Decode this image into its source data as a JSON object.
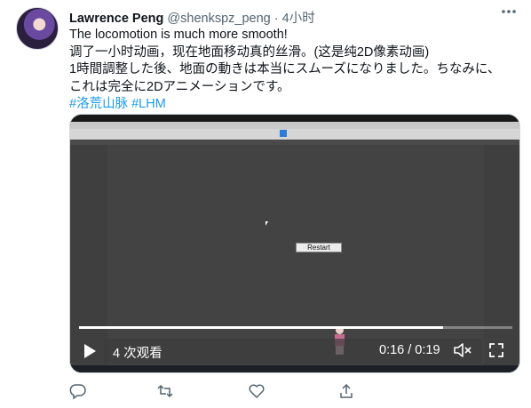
{
  "tweet": {
    "author_name": "Lawrence Peng",
    "handle": "@shenkspz_peng",
    "separator": "·",
    "time": "4小时",
    "lines": [
      "The locomotion is much more smooth!",
      "调了一小时动画，现在地面移动真的丝滑。(这是纯2D像素动画)",
      "1時間調整した後、地面の動きは本当にスムーズになりました。ちなみに、",
      "これは完全に2Dアニメーションです。"
    ],
    "hashtags": [
      "#洛荒山脉",
      "#LHM"
    ]
  },
  "video": {
    "restart_label": "Restart",
    "views": "4 次观看",
    "time_readout": "0:16 / 0:19",
    "progress": 0.84
  },
  "icons": {
    "more": "more-horizontal-icon",
    "play": "play-icon",
    "mute": "volume-muted-icon",
    "fullscreen": "fullscreen-icon",
    "reply": "reply-icon",
    "retweet": "retweet-icon",
    "like": "like-icon",
    "share": "share-icon"
  },
  "colors": {
    "link": "#1d9bf0",
    "secondary_text": "#536471",
    "icon": "#536471"
  }
}
